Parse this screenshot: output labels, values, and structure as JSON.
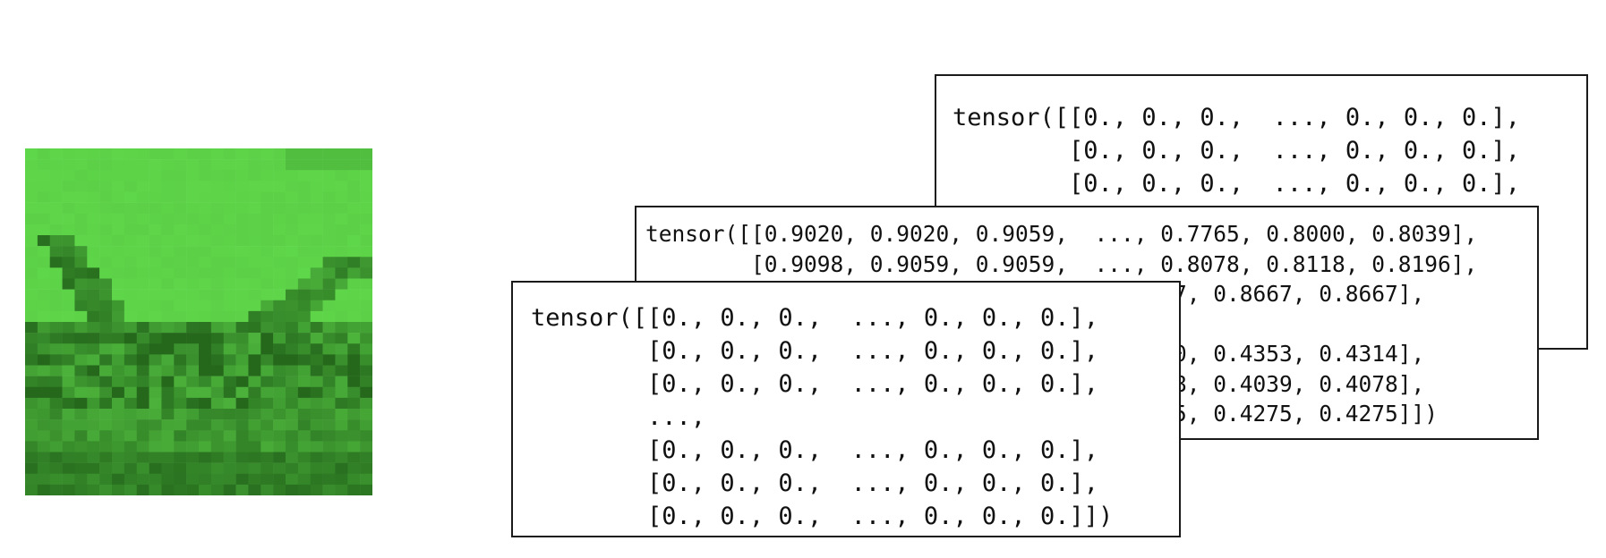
{
  "image": {
    "description_icon": "green-channel-pixel-image",
    "colors": [
      "#5fdc4b",
      "#3b9a2c",
      "#1e5a17"
    ]
  },
  "panels": {
    "back": {
      "lines": [
        "tensor([[0., 0., 0.,  ..., 0., 0., 0.],",
        "        [0., 0., 0.,  ..., 0., 0., 0.],",
        "        [0., 0., 0.,  ..., 0., 0., 0.],",
        "",
        "                                      ,",
        "                                      ,",
        "                                      ])"
      ]
    },
    "middle": {
      "lines": [
        "tensor([[0.9020, 0.9020, 0.9059,  ..., 0.7765, 0.8000, 0.8039],",
        "        [0.9098, 0.9059, 0.9059,  ..., 0.8078, 0.8118, 0.8196],",
        "                                   0.8667, 0.8667, 0.8667],",
        "",
        "                                   0.4510, 0.4353, 0.4314],",
        "                                   0.4078, 0.4039, 0.4078],",
        "                                   0.4275, 0.4275, 0.4275]])"
      ]
    },
    "front": {
      "lines": [
        "tensor([[0., 0., 0.,  ..., 0., 0., 0.],",
        "        [0., 0., 0.,  ..., 0., 0., 0.],",
        "        [0., 0., 0.,  ..., 0., 0., 0.],",
        "        ...,",
        "        [0., 0., 0.,  ..., 0., 0., 0.],",
        "        [0., 0., 0.,  ..., 0., 0., 0.],",
        "        [0., 0., 0.,  ..., 0., 0., 0.]])"
      ]
    }
  }
}
